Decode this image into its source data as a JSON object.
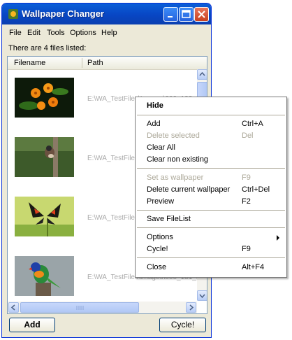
{
  "window": {
    "title": "Wallpaper Changer"
  },
  "menubar": [
    "File",
    "Edit",
    "Tools",
    "Options",
    "Help"
  ],
  "status": "There are 4 files listed:",
  "columns": [
    "Filename",
    "Path"
  ],
  "rows": [
    {
      "thumb": "orange-flowers",
      "path": "E:\\WA_TestFiles\\Images\\000_133_33"
    },
    {
      "thumb": "bird-on-branch",
      "path": "E:\\WA_TestFiles\\Images\\"
    },
    {
      "thumb": "butterfly",
      "path": "E:\\WA_TestFiles\\Images\\"
    },
    {
      "thumb": "parrot",
      "path": "E:\\WA_TestFiles\\Images\\000_131_34"
    }
  ],
  "buttons": {
    "add": "Add",
    "cycle": "Cycle!"
  },
  "context_menu": {
    "hide": "Hide",
    "add": {
      "label": "Add",
      "shortcut": "Ctrl+A"
    },
    "delete_selected": {
      "label": "Delete selected",
      "shortcut": "Del"
    },
    "clear_all": "Clear All",
    "clear_non_existing": "Clear non existing",
    "set_wallpaper": {
      "label": "Set as wallpaper",
      "shortcut": "F9"
    },
    "delete_current": {
      "label": "Delete current wallpaper",
      "shortcut": "Ctrl+Del"
    },
    "preview": {
      "label": "Preview",
      "shortcut": "F2"
    },
    "save_filelist": "Save FileList",
    "options": "Options",
    "cycle": {
      "label": "Cycle!",
      "shortcut": "F9"
    },
    "close": {
      "label": "Close",
      "shortcut": "Alt+F4"
    }
  },
  "colors": {
    "titlebar": "#0846c4",
    "accent": "#316ac5"
  }
}
